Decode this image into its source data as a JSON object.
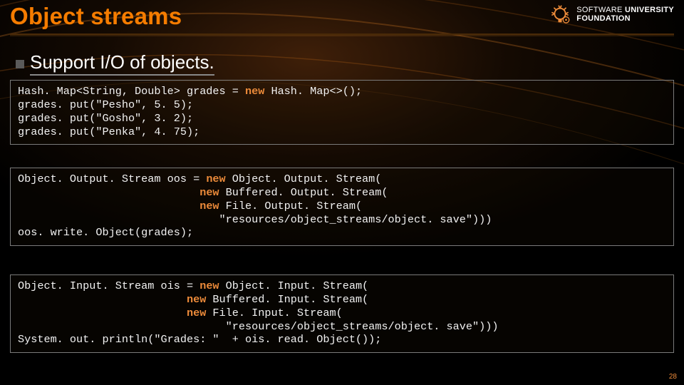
{
  "pageTitle": "Object streams",
  "brand": {
    "line1": "SOFTWARE UNIVERSITY",
    "line2": "FOUNDATION"
  },
  "bulletText": "Support I/O of objects.",
  "code": {
    "block1": {
      "l1a": "Hash. Map<String, Double> grades = ",
      "l1_new": "new",
      "l1b": " Hash. Map<>();",
      "l2": "grades. put(\"Pesho\", 5. 5);",
      "l3": "grades. put(\"Gosho\", 3. 2);",
      "l4": "grades. put(\"Penka\", 4. 75);"
    },
    "block2": {
      "l1a": "Object. Output. Stream oos = ",
      "l1_new": "new",
      "l1b": " Object. Output. Stream(",
      "pad1": "                            ",
      "l2_new": "new",
      "l2b": " Buffered. Output. Stream(",
      "l3_new": "new",
      "l3b": " File. Output. Stream(",
      "pad2": "                               ",
      "l4": "\"resources/object_streams/object. save\")))",
      "l5": "oos. write. Object(grades);"
    },
    "block3": {
      "l1a": "Object. Input. Stream ois = ",
      "l1_new": "new",
      "l1b": " Object. Input. Stream(",
      "pad1": "                          ",
      "l2_new": "new",
      "l2b": " Buffered. Input. Stream(",
      "l3_new": "new",
      "l3b": " File. Input. Stream(",
      "pad2": "                                ",
      "l4": "\"resources/object_streams/object. save\")))",
      "l5": "System. out. println(\"Grades: \"  + ois. read. Object());"
    }
  },
  "pageNumber": "28"
}
